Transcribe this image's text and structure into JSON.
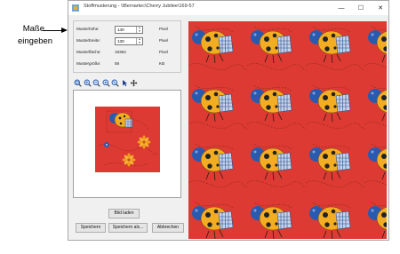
{
  "annotation": {
    "line1": "Maße",
    "line2": "eingeben"
  },
  "window": {
    "title": "Stoffmusterung - \\\\Bernartec\\Cherry Jubilee\\169-57",
    "min_glyph": "—",
    "max_glyph": "☐",
    "close_glyph": "✕"
  },
  "fields": {
    "height_label": "Musterhöhe:",
    "height_value": "140",
    "height_unit": "Pixel",
    "width_label": "Musterbreite:",
    "width_value": "130",
    "width_unit": "Pixel",
    "area_label": "Musterfläche:",
    "area_value": "19364",
    "area_unit": "Pixel",
    "size_label": "Mustergröße:",
    "size_value": "58",
    "size_unit": "KB"
  },
  "toolbar": {
    "icons": [
      "zoom-fit-icon",
      "zoom-in-icon",
      "zoom-out-icon",
      "zoom-1to1-icon",
      "zoom-window-icon",
      "select-icon",
      "move-icon"
    ]
  },
  "buttons": {
    "load": "Bild laden",
    "save": "Speichern",
    "save_as": "Speichern als...",
    "cancel": "Abbrechen"
  },
  "colors": {
    "fabric": "#dc3a32",
    "ladybug_body": "#f3ad22",
    "ladybug_head": "#2a5ab0",
    "check": "#2b4f8f",
    "flower": "#f29d1b"
  }
}
